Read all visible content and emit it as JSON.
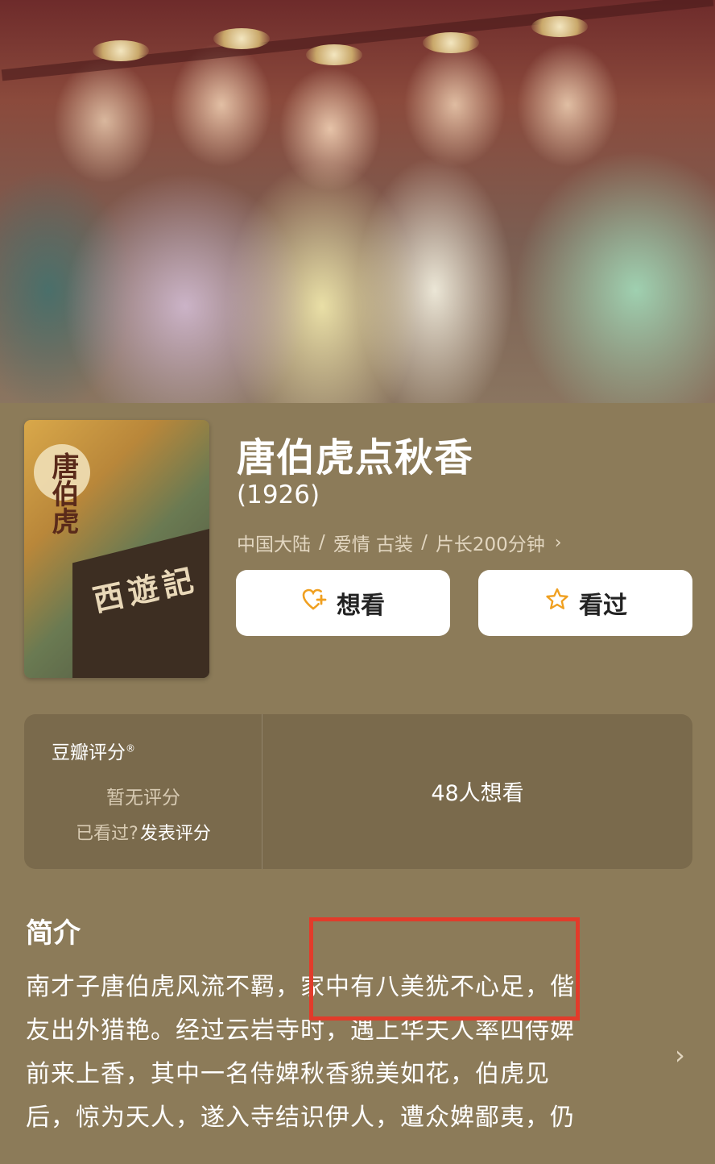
{
  "hero": {
    "image": "film-still-eight-women-in-costume"
  },
  "poster": {
    "vertical_title": "唐伯虎",
    "bottom_title": "西遊記"
  },
  "movie": {
    "title": "唐伯虎点秋香",
    "year": "(1926)",
    "region": "中国大陆",
    "genres": "爱情 古装",
    "runtime": "片长200分钟",
    "separator": "/"
  },
  "actions": {
    "want_label": "想看",
    "want_icon": "heart-plus-icon",
    "seen_label": "看过",
    "seen_icon": "star-icon"
  },
  "rating": {
    "label": "豆瓣评分",
    "trademark": "®",
    "none_text": "暂无评分",
    "seen_prompt": "已看过?",
    "rate_link": "发表评分",
    "want_count": "48人想看"
  },
  "intro": {
    "title": "简介",
    "lines": [
      "南才子唐伯虎风流不羁，家中有八美犹不心足，偕",
      "友出外猎艳。经过云岩寺时，遇上华夫人率四侍婢",
      "前来上香，其中一名侍婢秋香貌美如花，伯虎见",
      "后，惊为天人，遂入寺结识伊人，遭众婢鄙夷，仍"
    ]
  },
  "colors": {
    "background": "#8c7b59",
    "card": "#7a6a4c",
    "accent": "#f0a020",
    "highlight": "#e23b2a"
  }
}
